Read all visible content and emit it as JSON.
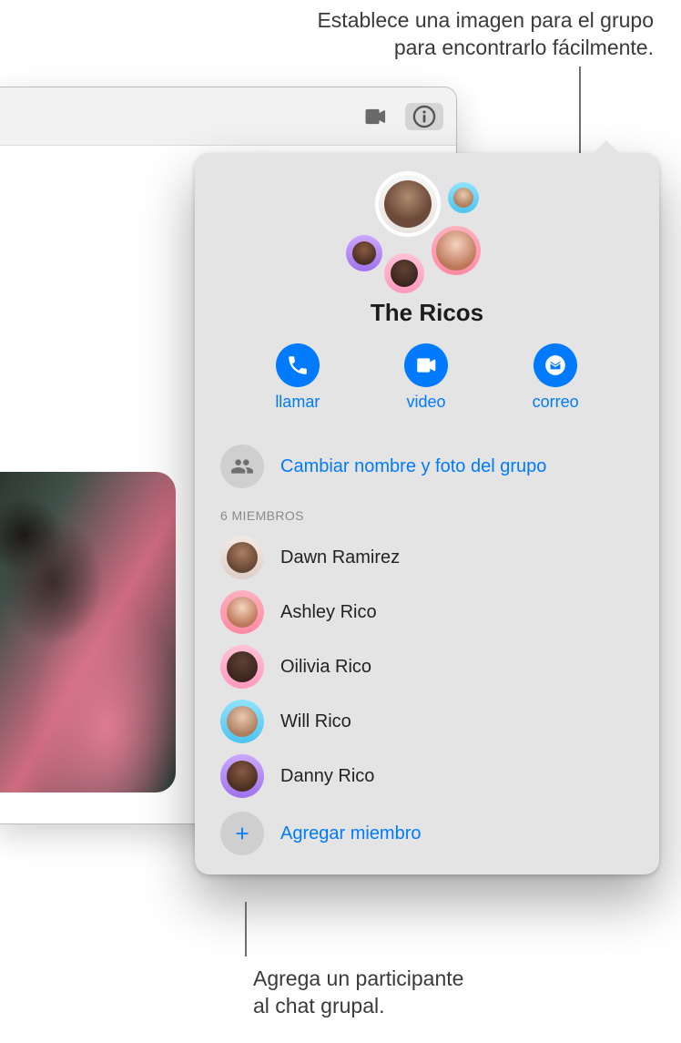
{
  "callouts": {
    "top_line1": "Establece una imagen para el grupo",
    "top_line2": "para encontrarlo fácilmente.",
    "bottom_line1": "Agrega un participante",
    "bottom_line2": "al chat grupal."
  },
  "toolbar": {
    "video_icon": "video",
    "info_icon": "info"
  },
  "popover": {
    "group_name": "The Ricos",
    "actions": {
      "call": "llamar",
      "video": "video",
      "mail": "correo"
    },
    "change_group_label": "Cambiar nombre y foto del grupo",
    "members_header": "6 MIEMBROS",
    "members": [
      {
        "name": "Dawn Ramirez"
      },
      {
        "name": "Ashley Rico"
      },
      {
        "name": "Oilivia Rico"
      },
      {
        "name": "Will Rico"
      },
      {
        "name": "Danny Rico"
      }
    ],
    "add_member_label": "Agregar miembro"
  }
}
